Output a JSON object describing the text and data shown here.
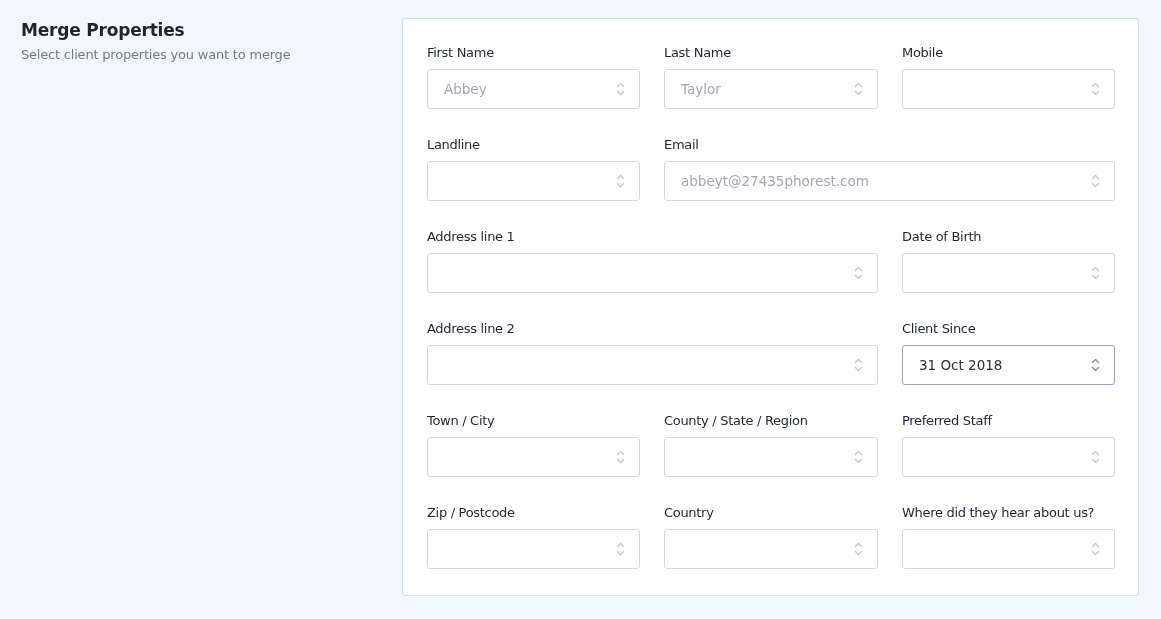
{
  "header": {
    "title": "Merge Properties",
    "subtitle": "Select client properties you want to merge"
  },
  "fields": [
    {
      "label": "First Name",
      "value": "Abbey",
      "kind": "select",
      "disabled": true
    },
    {
      "label": "Last Name",
      "value": "Taylor",
      "kind": "select",
      "disabled": true
    },
    {
      "label": "Mobile",
      "kind": "select",
      "disabled": true
    },
    {
      "label": "Landline",
      "kind": "select",
      "disabled": true
    },
    {
      "label": "Email",
      "value": "abbeyt@27435phorest.com",
      "kind": "select-wide",
      "disabled": true
    },
    {
      "label": "Address line 1",
      "kind": "select-wide",
      "disabled": true
    },
    {
      "label": "Date of Birth",
      "kind": "select",
      "disabled": true
    },
    {
      "label": "Address line 2",
      "kind": "select-wide",
      "disabled": true
    },
    {
      "label": "Client Since",
      "value": "31 Oct 2018",
      "kind": "select",
      "disabled": false
    },
    {
      "label": "Town / City",
      "kind": "select",
      "disabled": true
    },
    {
      "label": "County / State / Region",
      "kind": "select",
      "disabled": true
    },
    {
      "label": "Preferred Staff",
      "kind": "select",
      "disabled": true
    },
    {
      "label": "Zip / Postcode",
      "kind": "select",
      "disabled": true
    },
    {
      "label": "Country",
      "kind": "select",
      "disabled": true
    },
    {
      "label": "Where did they hear about us?",
      "kind": "select",
      "disabled": true
    }
  ]
}
